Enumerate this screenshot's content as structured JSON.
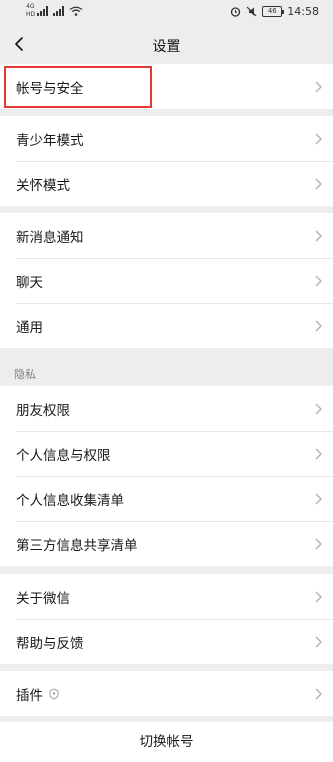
{
  "status_bar": {
    "sim1": "4G",
    "sim2": "HD",
    "battery": "46",
    "time": "14:58"
  },
  "nav": {
    "title": "设置"
  },
  "groups": [
    {
      "items": [
        {
          "label": "帐号与安全"
        }
      ]
    },
    {
      "items": [
        {
          "label": "青少年模式"
        },
        {
          "label": "关怀模式"
        }
      ]
    },
    {
      "items": [
        {
          "label": "新消息通知"
        },
        {
          "label": "聊天"
        },
        {
          "label": "通用"
        }
      ]
    },
    {
      "header": "隐私",
      "items": [
        {
          "label": "朋友权限"
        },
        {
          "label": "个人信息与权限"
        },
        {
          "label": "个人信息收集清单"
        },
        {
          "label": "第三方信息共享清单"
        }
      ]
    },
    {
      "items": [
        {
          "label": "关于微信"
        },
        {
          "label": "帮助与反馈"
        }
      ]
    },
    {
      "items": [
        {
          "label": "插件"
        }
      ]
    }
  ],
  "footer": {
    "switch_account": "切换帐号"
  },
  "colors": {
    "background": "#ededed",
    "cell": "#ffffff",
    "highlight": "#e53935"
  }
}
